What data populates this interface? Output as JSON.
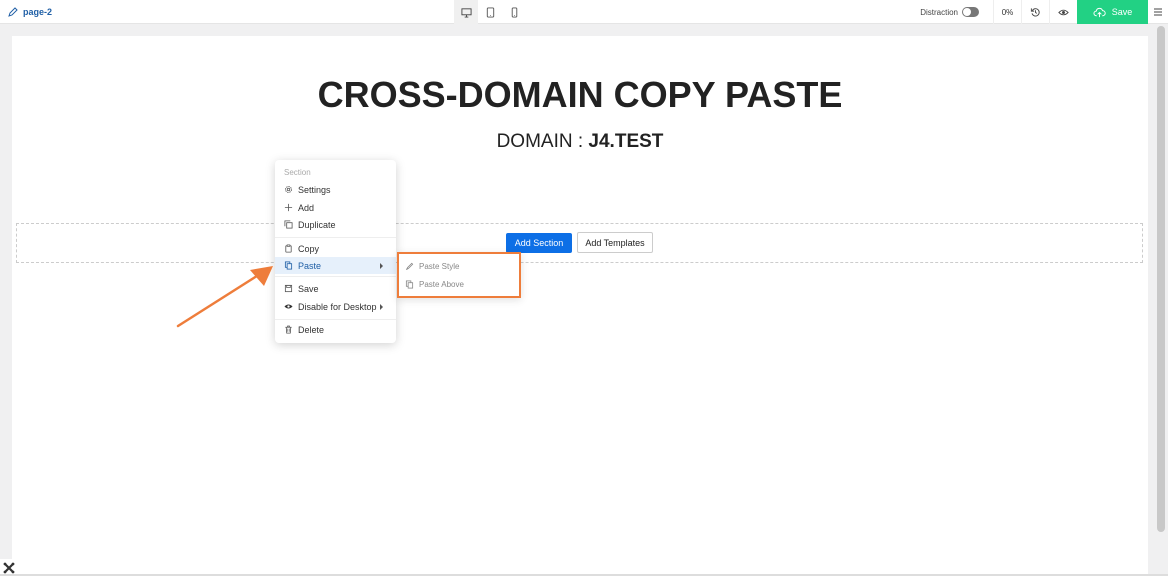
{
  "topbar": {
    "page_name": "page-2",
    "distraction_label": "Distraction",
    "zoom": "0%",
    "save_label": "Save"
  },
  "canvas": {
    "title": "CROSS-DOMAIN COPY PASTE",
    "subtitle_prefix": "DOMAIN : ",
    "subtitle_domain": "J4.TEST",
    "add_section": "Add Section",
    "add_templates": "Add Templates"
  },
  "context_menu": {
    "header": "Section",
    "items": [
      {
        "label": "Settings",
        "icon": "gear-icon"
      },
      {
        "label": "Add",
        "icon": "plus-icon"
      },
      {
        "label": "Duplicate",
        "icon": "duplicate-icon"
      },
      {
        "label": "Copy",
        "icon": "copy-icon"
      },
      {
        "label": "Paste",
        "icon": "paste-icon"
      },
      {
        "label": "Save",
        "icon": "save-icon"
      },
      {
        "label": "Disable for Desktop",
        "icon": "eye-icon"
      },
      {
        "label": "Delete",
        "icon": "trash-icon"
      }
    ]
  },
  "submenu": {
    "items": [
      {
        "label": "Paste Style",
        "icon": "brush-icon"
      },
      {
        "label": "Paste Above",
        "icon": "paste-icon"
      }
    ]
  },
  "colors": {
    "accent_blue": "#0d6fe6",
    "save_green": "#22d184",
    "highlight_orange": "#ee7d3b"
  }
}
